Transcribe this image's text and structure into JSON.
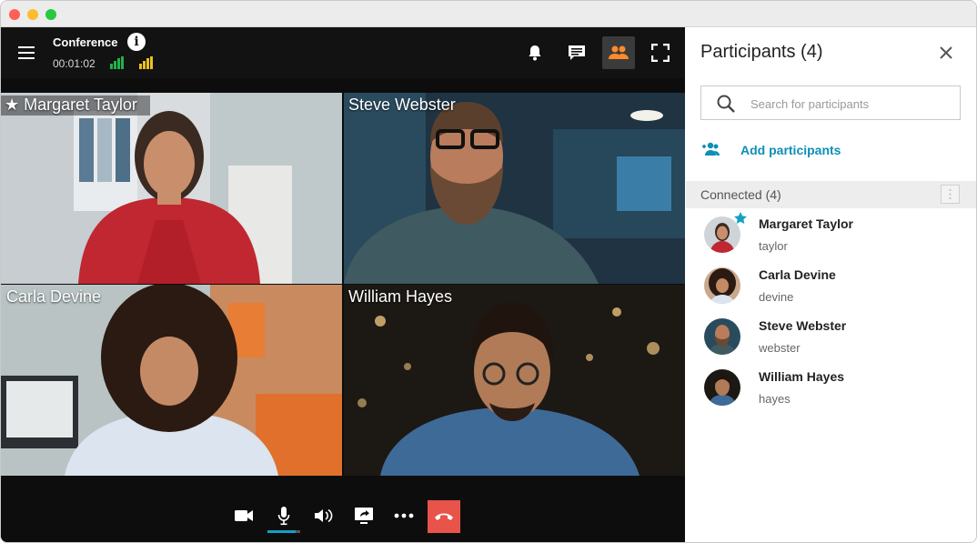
{
  "window": {
    "controls": [
      "close",
      "minimize",
      "zoom"
    ]
  },
  "conference": {
    "title": "Conference",
    "timer": "00:01:02",
    "signal_colors": [
      "#21b24b",
      "#e8c21f"
    ]
  },
  "topbar_icons": [
    "menu-icon",
    "info-icon",
    "bell-icon",
    "chat-icon",
    "participants-icon",
    "fullscreen-icon"
  ],
  "tiles": [
    {
      "name": "Margaret Taylor",
      "starred": true
    },
    {
      "name": "Steve Webster",
      "starred": false
    },
    {
      "name": "Carla Devine",
      "starred": false
    },
    {
      "name": "William Hayes",
      "starred": false
    }
  ],
  "controls": {
    "icons": [
      "camera-icon",
      "microphone-icon",
      "speaker-icon",
      "screen-share-icon",
      "more-icon",
      "hang-up-icon"
    ],
    "mic_level": 0.85,
    "accent": "#13a0c7",
    "hangup_color": "#e8534a"
  },
  "panel": {
    "title": "Participants (4)",
    "search_placeholder": "Search for participants",
    "add_label": "Add participants",
    "section_label": "Connected (4)",
    "accent": "#0d8fb6",
    "participants": [
      {
        "name": "Margaret Taylor",
        "username": "taylor",
        "starred": true
      },
      {
        "name": "Carla Devine",
        "username": "devine",
        "starred": false
      },
      {
        "name": "Steve Webster",
        "username": "webster",
        "starred": false
      },
      {
        "name": "William Hayes",
        "username": "hayes",
        "starred": false
      }
    ]
  }
}
